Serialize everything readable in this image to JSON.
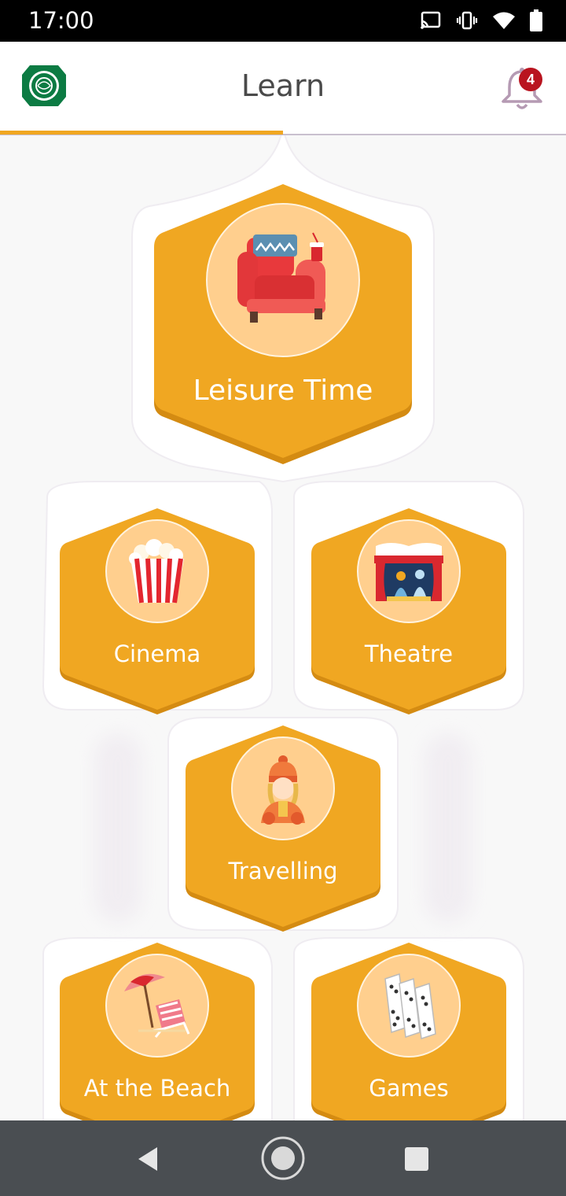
{
  "status_bar": {
    "time": "17:00",
    "icons": [
      "cast-icon",
      "vibrate-icon",
      "wifi-icon",
      "battery-icon"
    ]
  },
  "header": {
    "title": "Learn",
    "notification_count": "4",
    "progress_fraction": 0.5
  },
  "topics": [
    {
      "label": "Leisure Time",
      "icon": "armchair-icon"
    },
    {
      "label": "Cinema",
      "icon": "popcorn-icon"
    },
    {
      "label": "Theatre",
      "icon": "theatre-stage-icon"
    },
    {
      "label": "Travelling",
      "icon": "traveller-icon"
    },
    {
      "label": "At the Beach",
      "icon": "beach-chair-icon"
    },
    {
      "label": "Games",
      "icon": "dominoes-icon"
    }
  ],
  "colors": {
    "accent": "#f0a722",
    "hex_shadow": "#d48b12",
    "icon_circle": "#ffcf8e",
    "badge": "#b9141f",
    "nav_bar": "#4a4e52"
  },
  "nav": [
    "back-button",
    "home-button",
    "recents-button"
  ]
}
